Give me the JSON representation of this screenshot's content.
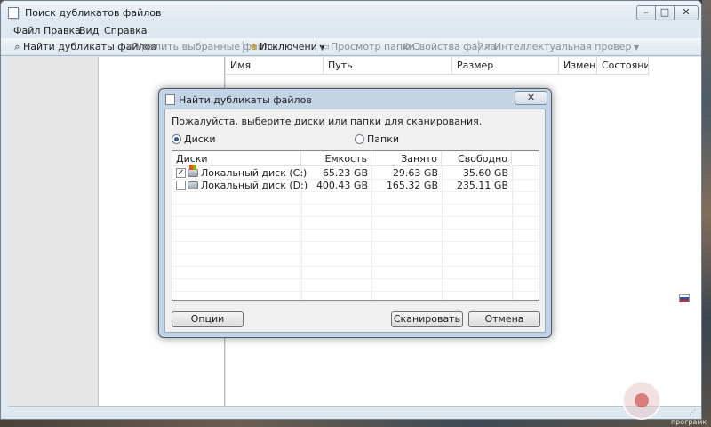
{
  "window": {
    "title": "Поиск дубликатов файлов",
    "controls": {
      "minimize": "–",
      "maximize": "□",
      "close": "✕"
    }
  },
  "menu": [
    "Файл",
    "Правка",
    "Вид",
    "Справка"
  ],
  "toolbar": {
    "find_duplicates": "Найти дубликаты файлов",
    "delete_selected": "Удалить выбранные файлы",
    "exclusions": "Исключени",
    "view_folder": "Просмотр папки",
    "file_properties": "Свойства файла",
    "smart_check": "Интеллектуальная провер"
  },
  "results_columns": [
    "Имя",
    "Путь",
    "Размер",
    "Изменен",
    "Состояни"
  ],
  "dialog": {
    "title": "Найти дубликаты файлов",
    "close": "✕",
    "prompt": "Пожалуйста, выберите диски или папки для сканирования.",
    "radio_disks": "Диски",
    "radio_folders": "Папки",
    "selected_mode": "disks",
    "columns": [
      "Диски",
      "Емкость",
      "Занято",
      "Свободно"
    ],
    "drives": [
      {
        "checked": true,
        "check_glyph": "✓",
        "name": "Локальный диск (C:)",
        "capacity": "65.23 GB",
        "used": "29.63 GB",
        "free": "35.60 GB"
      },
      {
        "checked": false,
        "check_glyph": "",
        "name": "Локальный диск (D:)",
        "capacity": "400.43 GB",
        "used": "165.32 GB",
        "free": "235.11 GB"
      }
    ],
    "buttons": {
      "options": "Опции",
      "scan": "Сканировать",
      "cancel": "Отмена"
    }
  },
  "watermark_text": "програмк",
  "status_grip": "⋰",
  "colors": {
    "window_chrome": "#dfe7f0",
    "dialog_frame": "#c3d4e7",
    "radio_selected": "#2a5f9e"
  },
  "icons": {
    "find": "search-icon",
    "delete": "x-icon",
    "exclusions": "folder-star-icon",
    "view_folder": "folder-view-icon",
    "properties": "properties-icon",
    "smart": "checkmark-icon"
  }
}
